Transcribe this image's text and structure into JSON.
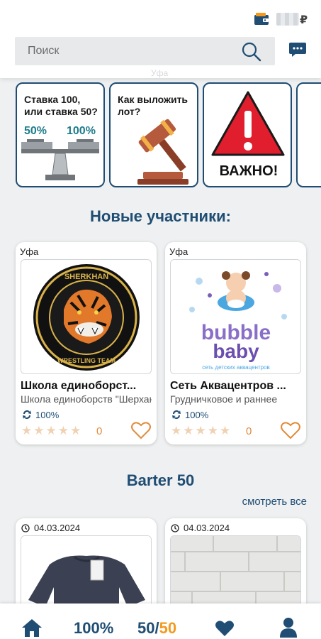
{
  "header": {
    "currency": "₽",
    "search_placeholder": "Поиск",
    "city_ghost": "Уфа"
  },
  "banners": [
    {
      "title": "Ставка 100, или ставка 50?",
      "line1": "Ставка 100,",
      "line2": "или ставка 50?",
      "left_pct": "50%",
      "right_pct": "100%"
    },
    {
      "line1": "Как выложить",
      "line2": "лот?"
    },
    {
      "label": "ВАЖНО!"
    }
  ],
  "new_members": {
    "title": "Новые участники:",
    "cards": [
      {
        "city": "Уфа",
        "name": "Школа единоборст...",
        "description": "Школа единоборств \"Шерхан\"",
        "percent": "100%",
        "rating": 0,
        "logo_top": "SHERKHAN",
        "logo_bottom": "WRESTLING TEAM"
      },
      {
        "city": "Уфа",
        "name": "Сеть Аквацентров ...",
        "description": "Грудничковое и раннее",
        "percent": "100%",
        "rating": 0,
        "logo_word1": "bubble",
        "logo_word2": "baby",
        "logo_sub": "сеть детских аквацентров"
      }
    ]
  },
  "barter": {
    "title": "Barter 50",
    "view_all": "смотреть все",
    "items": [
      {
        "date": "04.03.2024"
      },
      {
        "date": "04.03.2024"
      }
    ]
  },
  "bottom_nav": {
    "percent": "100%",
    "fifty_a": "50",
    "slash": "/",
    "fifty_b": "50"
  },
  "colors": {
    "primary": "#1f4d73",
    "accent": "#f39a1e",
    "teal": "#1e7c8c",
    "danger": "#e01e2d"
  }
}
